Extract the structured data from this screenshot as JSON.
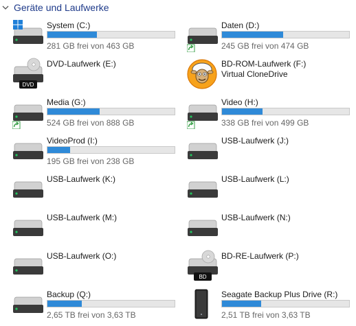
{
  "section": {
    "title": "Geräte und Laufwerke"
  },
  "drives": [
    {
      "label": "System (C:)",
      "subtitle": "281 GB frei von 463 GB",
      "used_fraction": 0.39,
      "icon": "hdd-windows"
    },
    {
      "label": "Daten (D:)",
      "subtitle": "245 GB frei von 474 GB",
      "used_fraction": 0.48,
      "icon": "hdd-shared"
    },
    {
      "label": "DVD-Laufwerk (E:)",
      "icon": "dvd-drive",
      "badge": "DVD"
    },
    {
      "label": "BD-ROM-Laufwerk (F:) Virtual CloneDrive",
      "icon": "clonedrive-sheep"
    },
    {
      "label": "Media (G:)",
      "subtitle": "524 GB frei von 888 GB",
      "used_fraction": 0.41,
      "icon": "hdd-shared"
    },
    {
      "label": "Video (H:)",
      "subtitle": "338 GB frei von 499 GB",
      "used_fraction": 0.32,
      "icon": "hdd-shared"
    },
    {
      "label": "VideoProd (I:)",
      "subtitle": "195 GB frei von 238 GB",
      "used_fraction": 0.18,
      "icon": "hdd"
    },
    {
      "label": "USB-Laufwerk (J:)",
      "icon": "hdd"
    },
    {
      "label": "USB-Laufwerk (K:)",
      "icon": "hdd"
    },
    {
      "label": "USB-Laufwerk (L:)",
      "icon": "hdd"
    },
    {
      "label": "USB-Laufwerk (M:)",
      "icon": "hdd"
    },
    {
      "label": "USB-Laufwerk (N:)",
      "icon": "hdd"
    },
    {
      "label": "USB-Laufwerk (O:)",
      "icon": "hdd"
    },
    {
      "label": "BD-RE-Laufwerk (P:)",
      "icon": "bd-drive",
      "badge": "BD"
    },
    {
      "label": "Backup (Q:)",
      "subtitle": "2,65 TB frei von 3,63 TB",
      "used_fraction": 0.27,
      "icon": "hdd"
    },
    {
      "label": "Seagate Backup Plus Drive (R:)",
      "subtitle": "2,51 TB frei von 3,63 TB",
      "used_fraction": 0.31,
      "icon": "external-hdd"
    }
  ],
  "colors": {
    "accent": "#2f8ad8",
    "header": "#1e3a8a",
    "usb_led": "#22c55e",
    "shortcut": "#3aa24a"
  }
}
